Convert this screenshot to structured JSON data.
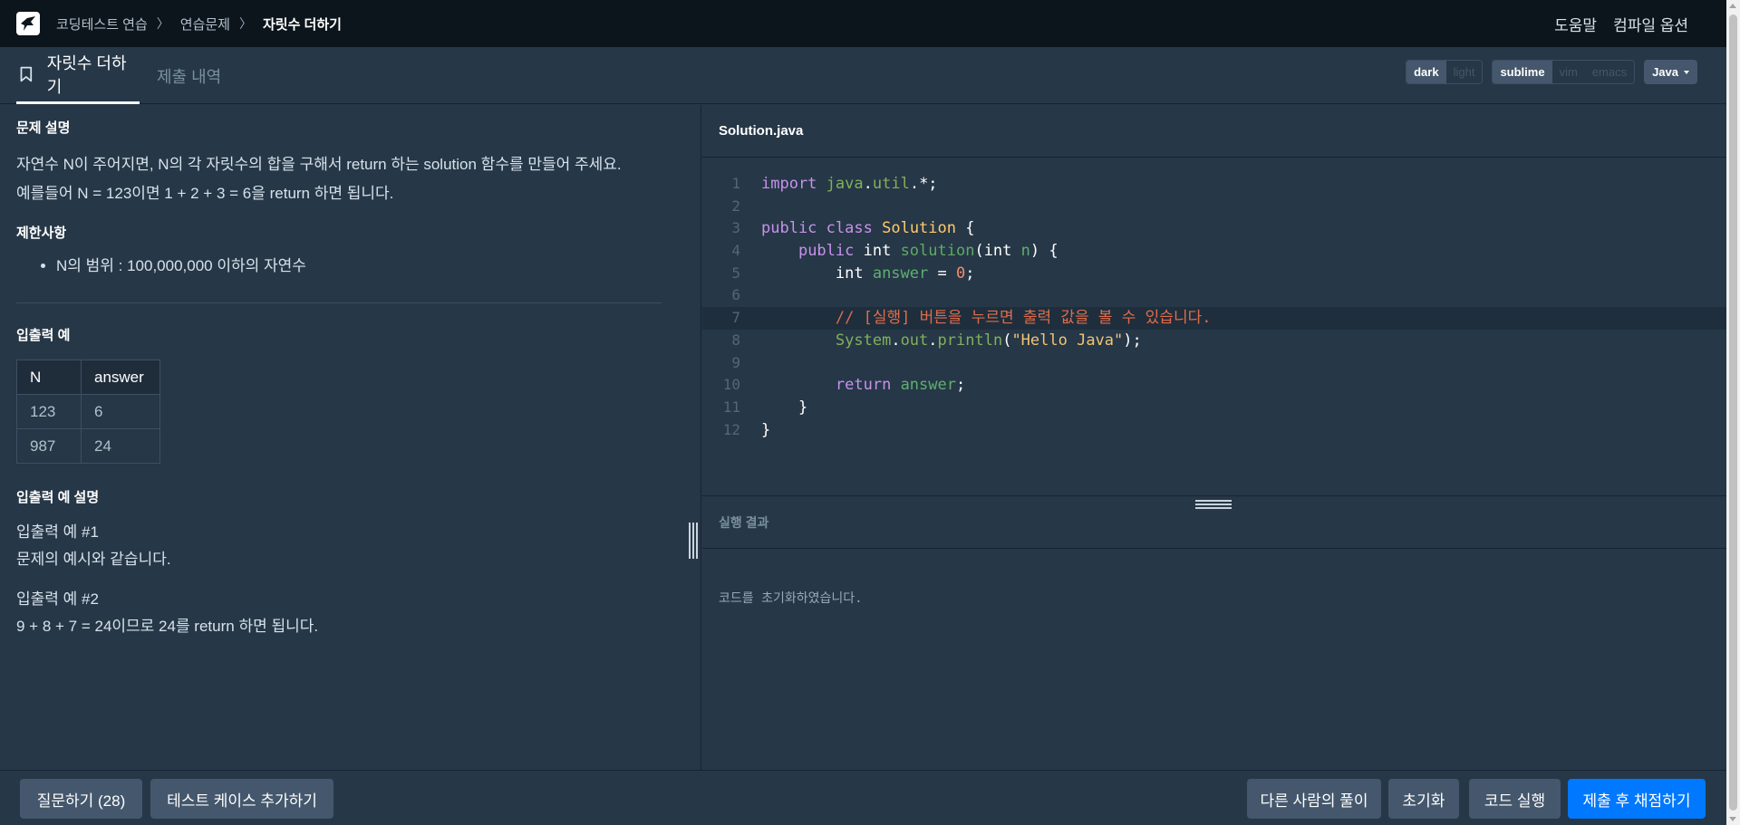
{
  "breadcrumb": [
    "코딩테스트 연습",
    "연습문제",
    "자릿수 더하기"
  ],
  "topnav": {
    "help": "도움말",
    "compile_options": "컴파일 옵션"
  },
  "tabs": {
    "problem": "자릿수 더하기",
    "submissions": "제출 내역"
  },
  "theme": {
    "dark": "dark",
    "light": "light",
    "selected": "dark"
  },
  "keymap": {
    "sublime": "sublime",
    "vim": "vim",
    "emacs": "emacs",
    "selected": "sublime"
  },
  "language": "Java",
  "problem": {
    "desc_title": "문제 설명",
    "desc_line1": "자연수 N이 주어지면, N의 각 자릿수의 합을 구해서 return 하는 solution 함수를 만들어 주세요.",
    "desc_line2": "예를들어 N = 123이면 1 + 2 + 3 = 6을 return 하면 됩니다.",
    "constraints_title": "제한사항",
    "constraint1": "N의 범위 : 100,000,000 이하의 자연수",
    "io_title": "입출력 예",
    "io_headers": [
      "N",
      "answer"
    ],
    "io_rows": [
      [
        "123",
        "6"
      ],
      [
        "987",
        "24"
      ]
    ],
    "io_desc_title": "입출력 예 설명",
    "ex1_title": "입출력 예 #1",
    "ex1_text": "문제의 예시와 같습니다.",
    "ex2_title": "입출력 예 #2",
    "ex2_text": "9 + 8 + 7 = 24이므로 24를 return 하면 됩니다."
  },
  "editor": {
    "filename": "Solution.java",
    "line_numbers": [
      "1",
      "2",
      "3",
      "4",
      "5",
      "6",
      "7",
      "8",
      "9",
      "10",
      "11",
      "12"
    ],
    "highlighted_line": 7
  },
  "result": {
    "title": "실행 결과",
    "message": "코드를 초기화하였습니다."
  },
  "footer": {
    "ask": "질문하기 (28)",
    "add_testcase": "테스트 케이스 추가하기",
    "others": "다른 사람의 풀이",
    "reset": "초기화",
    "run": "코드 실행",
    "submit": "제출 후 채점하기"
  },
  "colors": {
    "primary": "#0078ff",
    "nav_bg": "#0c151c",
    "panel_bg": "#263747"
  }
}
